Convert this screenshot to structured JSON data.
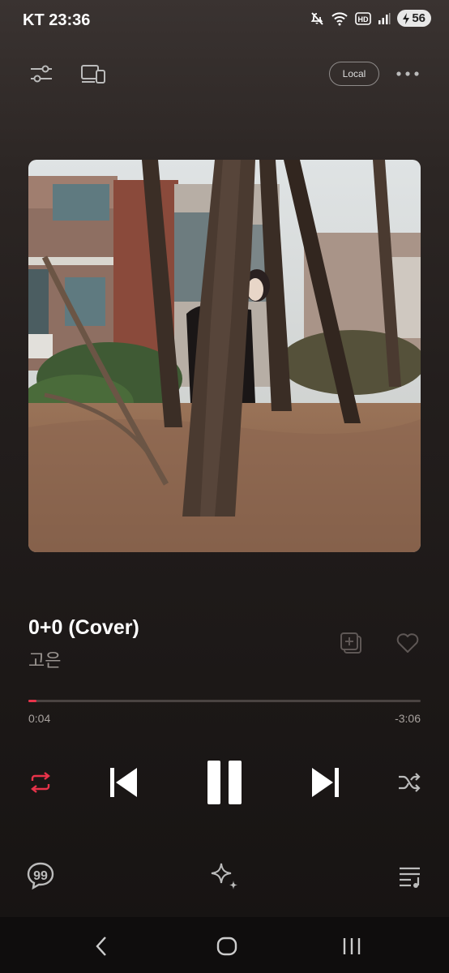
{
  "status_bar": {
    "carrier_time": "KT 23:36",
    "battery_level": "56",
    "icons": [
      "mute-icon",
      "wifi-icon",
      "hd-icon",
      "signal-icon",
      "battery-charging-icon"
    ]
  },
  "top_bar": {
    "equalizer_icon": "sliders-icon",
    "device_icon": "devices-icon",
    "local_label": "Local",
    "more_icon": "more-icon"
  },
  "album": {
    "art_description_icon": "album-art"
  },
  "track": {
    "title": "0+0 (Cover)",
    "artist": "고은",
    "add_icon": "add-to-playlist-icon",
    "like_icon": "heart-icon"
  },
  "progress": {
    "elapsed": "0:04",
    "remaining": "-3:06",
    "fraction": 0.02
  },
  "controls": {
    "repeat_icon": "repeat-icon",
    "prev_icon": "previous-icon",
    "pause_icon": "pause-icon",
    "next_icon": "next-icon",
    "shuffle_icon": "shuffle-icon",
    "accent_color": "#e8334a"
  },
  "bottom_actions": {
    "lyrics_icon": "lyrics-icon",
    "sparkle_icon": "sparkle-icon",
    "queue_icon": "queue-icon"
  },
  "navigation": {
    "back_icon": "back-icon",
    "home_icon": "home-icon",
    "recents_icon": "recents-icon"
  }
}
